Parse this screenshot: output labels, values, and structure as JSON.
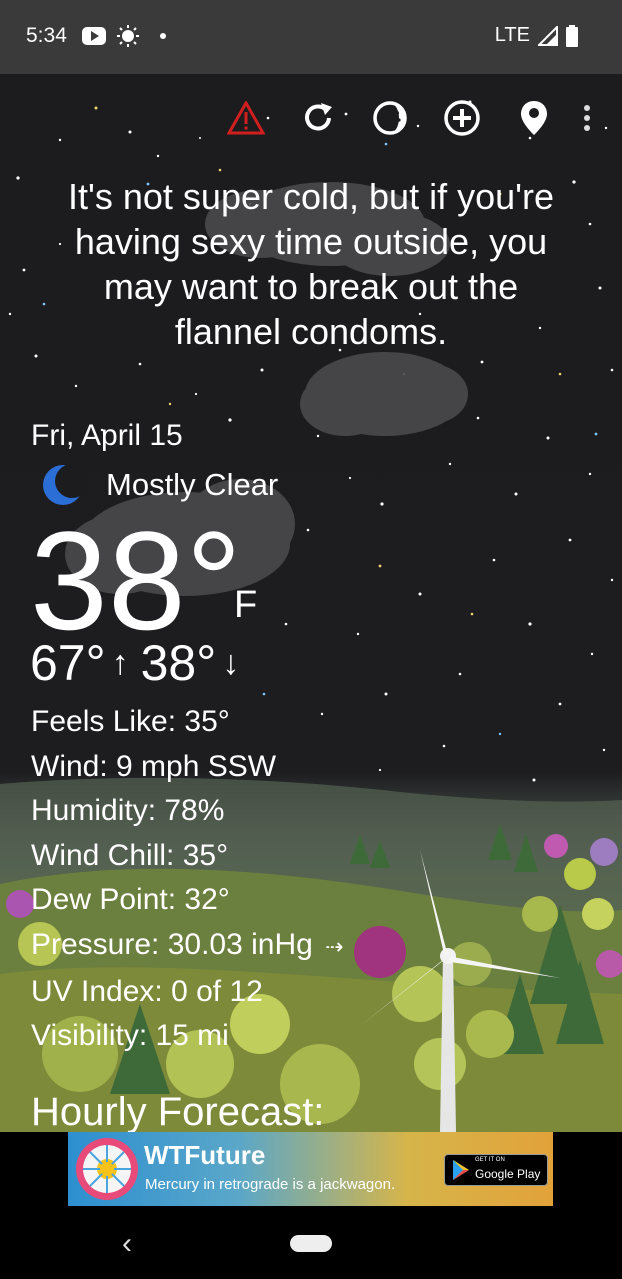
{
  "status": {
    "time": "5:34",
    "network": "LTE"
  },
  "toolbar": {
    "icons": [
      "alert-icon",
      "refresh-icon",
      "theme-icon",
      "add-location-icon",
      "location-icon",
      "more-icon"
    ]
  },
  "quip": {
    "line1": "It's not super cold, but if you're",
    "line2": "having sexy time outside, you",
    "line3": "may want to break out the",
    "line4": "flannel condoms."
  },
  "weather": {
    "date": "Fri, April 15",
    "condition": "Mostly Clear",
    "temp": "38°",
    "unit": "F",
    "high": "67°",
    "low": "38°",
    "details": {
      "feels_like": "Feels Like:  35°",
      "wind": "Wind:  9 mph SSW",
      "humidity": "Humidity:  78%",
      "wind_chill": "Wind Chill:  35°",
      "dew_point": "Dew Point:  32°",
      "pressure": "Pressure:  30.03 inHg",
      "uv_index": "UV Index:  0 of 12",
      "visibility": "Visibility:  15 mi"
    },
    "hourly_title": "Hourly Forecast:"
  },
  "ad": {
    "title": "WTFuture",
    "subtitle": "Mercury in retrograde is a jackwagon.",
    "store_small": "GET IT ON",
    "store_name": "Google Play"
  },
  "colors": {
    "alert": "#e02020",
    "moon": "#2b6fd6",
    "background": "#1c1c1e"
  }
}
